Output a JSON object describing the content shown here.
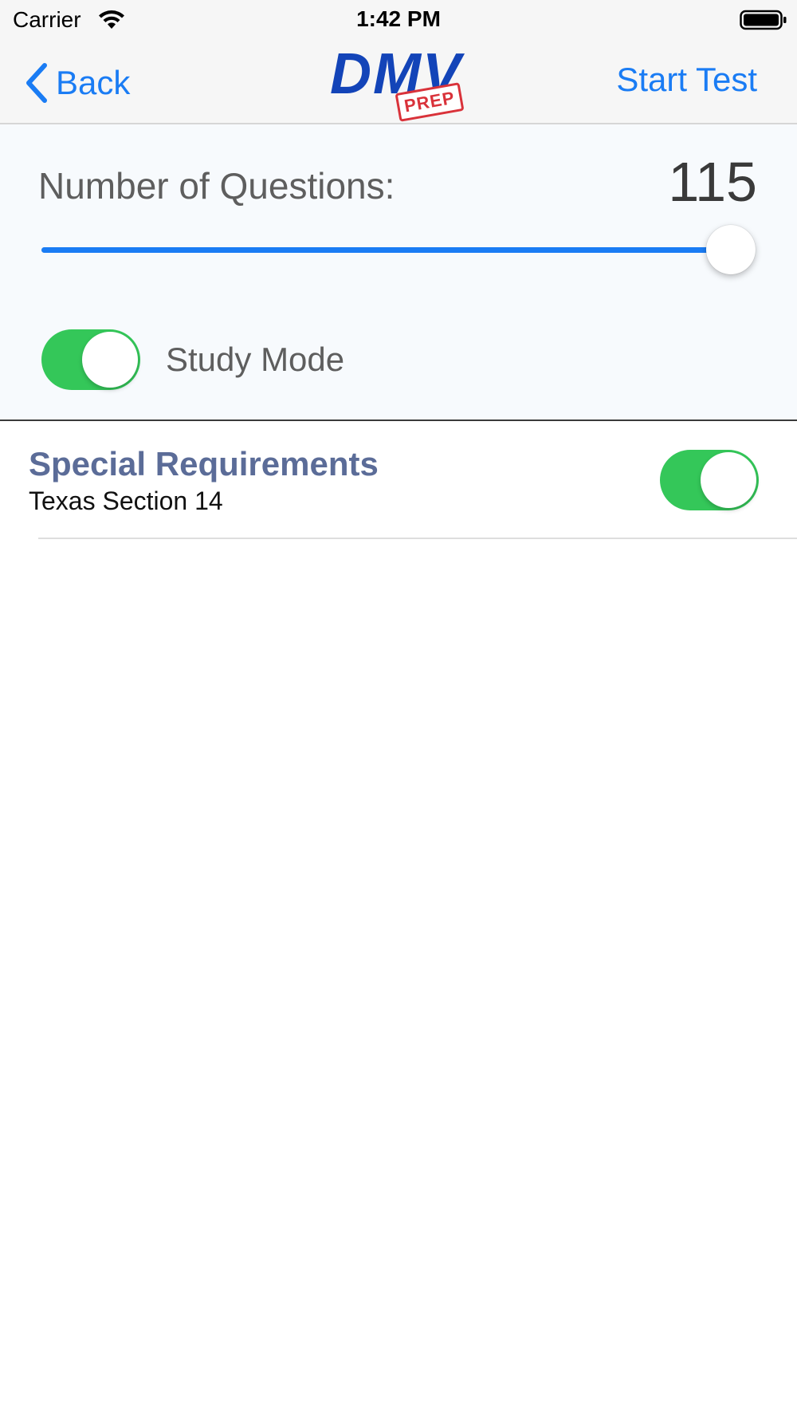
{
  "status_bar": {
    "carrier": "Carrier",
    "time": "1:42 PM",
    "icons": [
      "wifi-icon",
      "battery-icon"
    ]
  },
  "nav": {
    "back_label": "Back",
    "logo_main": "DMV",
    "logo_stamp": "PREP",
    "start_test_label": "Start Test",
    "accent_color": "#1a7cf4",
    "logo_color": "#1344b8",
    "stamp_color": "#d9323a"
  },
  "settings": {
    "questions_label": "Number of Questions:",
    "questions_value": "115",
    "slider_fraction": 1.0,
    "study_mode_label": "Study Mode",
    "study_mode_on": true,
    "toggle_on_color": "#34c759"
  },
  "sections": [
    {
      "title": "Special Requirements",
      "subtitle": "Texas Section 14",
      "enabled": true
    }
  ]
}
